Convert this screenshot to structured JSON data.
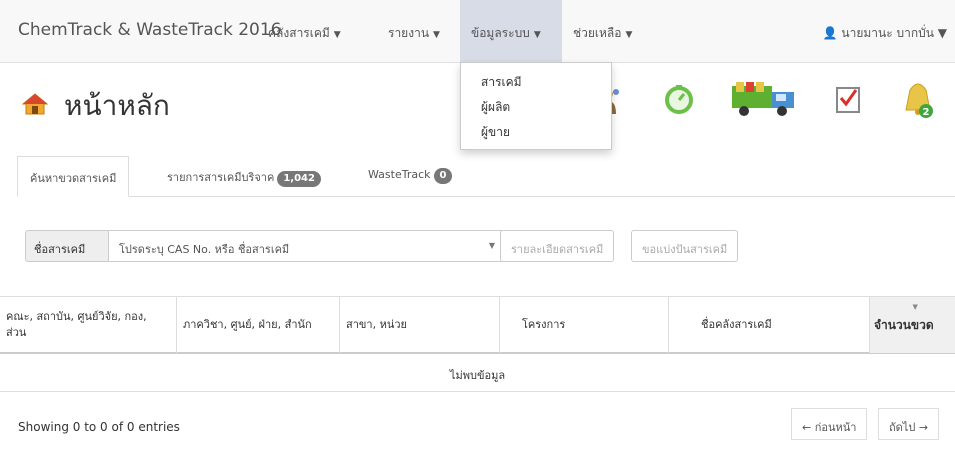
{
  "navbar": {
    "brand": "ChemTrack & WasteTrack 2016",
    "menus": [
      {
        "label": "คลังสารเคมี"
      },
      {
        "label": "รายงาน"
      },
      {
        "label": "ข้อมูลระบบ"
      },
      {
        "label": "ช่วยเหลือ"
      }
    ],
    "user": "นายมานะ บากบั่น"
  },
  "dropdown": {
    "items": [
      "สารเคมี",
      "ผู้ผลิต",
      "ผู้ขาย"
    ]
  },
  "page": {
    "title": "หน้าหลัก"
  },
  "toolbar_icons": {
    "bell_badge": "2",
    "colors": {
      "bell": "#e8c547",
      "badge": "#3fa63f",
      "truck": "#5fb030",
      "timer": "#6cc04a"
    }
  },
  "tabs": [
    {
      "label": "ค้นหาขวดสารเคมี"
    },
    {
      "label": "รายการสารเคมีบริจาค",
      "badge": "1,042"
    },
    {
      "label": "WasteTrack",
      "badge": "0"
    }
  ],
  "search": {
    "addon": "ชื่อสารเคมี",
    "placeholder": "โปรดระบุ CAS No. หรือ ชื่อสารเคมี",
    "detail_button": "รายละเอียดสารเคมี",
    "split_button": "ขอแบ่งปันสารเคมี"
  },
  "table": {
    "headers": [
      "คณะ, สถาบัน, ศูนย์วิจัย, กอง, ส่วน",
      "ภาควิชา, ศูนย์, ฝ่าย, สำนัก",
      "สาขา, หน่วย",
      "โครงการ",
      "ชื่อคลังสารเคมี",
      "จำนวนขวด"
    ],
    "empty": "ไม่พบข้อมูล",
    "info": "Showing 0 to 0 of 0 entries",
    "prev": "← ก่อนหน้า",
    "next": "ถัดไป →"
  }
}
